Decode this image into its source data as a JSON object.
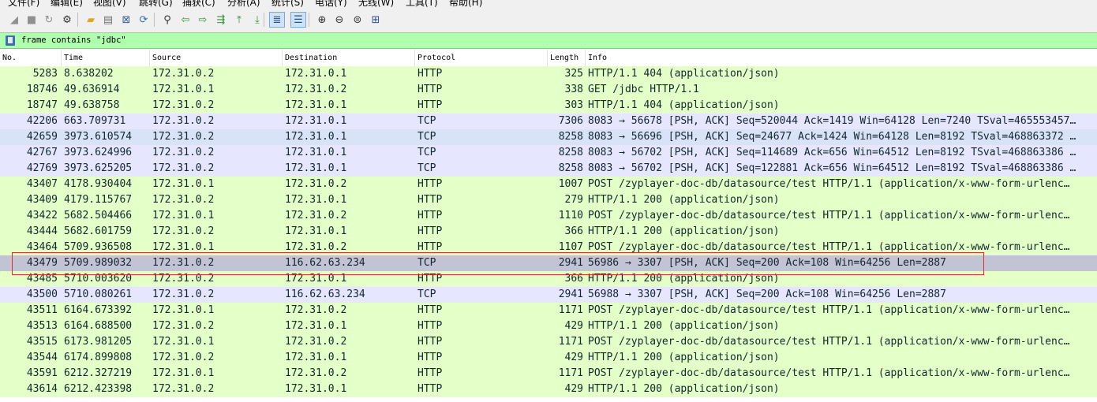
{
  "menu": [
    "文件(F)",
    "编辑(E)",
    "视图(V)",
    "跳转(G)",
    "捕获(C)",
    "分析(A)",
    "统计(S)",
    "电话(Y)",
    "无线(W)",
    "工具(T)",
    "帮助(H)"
  ],
  "toolbar": {
    "icons": [
      {
        "name": "start-capture-icon",
        "glyph": "◢",
        "color": "#909090"
      },
      {
        "name": "stop-capture-icon",
        "glyph": "■",
        "color": "#909090"
      },
      {
        "name": "restart-capture-icon",
        "glyph": "↻",
        "color": "#909090"
      },
      {
        "name": "capture-options-icon",
        "glyph": "⚙",
        "color": "#333333"
      },
      {
        "name": "open-file-icon",
        "glyph": "▰",
        "color": "#e0a526"
      },
      {
        "name": "save-file-icon",
        "glyph": "▤",
        "color": "#707070"
      },
      {
        "name": "close-file-icon",
        "glyph": "⊠",
        "color": "#3a5f9a"
      },
      {
        "name": "reload-file-icon",
        "glyph": "⟳",
        "color": "#2f6fb4"
      },
      {
        "name": "find-packet-icon",
        "glyph": "⚲",
        "color": "#303030"
      },
      {
        "name": "go-back-icon",
        "glyph": "⇦",
        "color": "#3e8f3e"
      },
      {
        "name": "go-forward-icon",
        "glyph": "⇨",
        "color": "#3e8f3e"
      },
      {
        "name": "go-to-packet-icon",
        "glyph": "⇶",
        "color": "#3e8f3e"
      },
      {
        "name": "go-first-packet-icon",
        "glyph": "⤒",
        "color": "#3e8f3e"
      },
      {
        "name": "go-last-packet-icon",
        "glyph": "⤓",
        "color": "#3e8f3e"
      },
      {
        "name": "auto-scroll-icon",
        "glyph": "≣",
        "color": "#2b4f8a"
      },
      {
        "name": "colorize-icon",
        "glyph": "☰",
        "color": "#2b4f8a"
      },
      {
        "name": "zoom-in-icon",
        "glyph": "⊕",
        "color": "#303030"
      },
      {
        "name": "zoom-out-icon",
        "glyph": "⊖",
        "color": "#303030"
      },
      {
        "name": "normal-size-icon",
        "glyph": "⊜",
        "color": "#303030"
      },
      {
        "name": "resize-columns-icon",
        "glyph": "⊞",
        "color": "#2b4f8a"
      }
    ]
  },
  "filter": {
    "text": "frame contains \"jdbc\"",
    "bg_color": "#afffaf"
  },
  "columns": {
    "no": "No.",
    "time": "Time",
    "source": "Source",
    "destination": "Destination",
    "protocol": "Protocol",
    "length": "Length",
    "info": "Info"
  },
  "packets": [
    {
      "no": "5283",
      "time": "8.638202",
      "src": "172.31.0.2",
      "dst": "172.31.0.1",
      "proto": "HTTP",
      "len": "325",
      "info": "HTTP/1.1 404   (application/json)",
      "color": "http"
    },
    {
      "no": "18746",
      "time": "49.636914",
      "src": "172.31.0.1",
      "dst": "172.31.0.2",
      "proto": "HTTP",
      "len": "338",
      "info": "GET /jdbc HTTP/1.1",
      "color": "http"
    },
    {
      "no": "18747",
      "time": "49.638758",
      "src": "172.31.0.2",
      "dst": "172.31.0.1",
      "proto": "HTTP",
      "len": "303",
      "info": "HTTP/1.1 404   (application/json)",
      "color": "http"
    },
    {
      "no": "42206",
      "time": "663.709731",
      "src": "172.31.0.2",
      "dst": "172.31.0.1",
      "proto": "TCP",
      "len": "7306",
      "info": "8083 → 56678 [PSH, ACK] Seq=520044 Ack=1419 Win=64128 Len=7240 TSval=465553457…",
      "color": "tcp"
    },
    {
      "no": "42659",
      "time": "3973.610574",
      "src": "172.31.0.2",
      "dst": "172.31.0.1",
      "proto": "TCP",
      "len": "8258",
      "info": "8083 → 56696 [PSH, ACK] Seq=24677 Ack=1424 Win=64128 Len=8192 TSval=468863372 …",
      "color": "tcp-alt"
    },
    {
      "no": "42767",
      "time": "3973.624996",
      "src": "172.31.0.2",
      "dst": "172.31.0.1",
      "proto": "TCP",
      "len": "8258",
      "info": "8083 → 56702 [PSH, ACK] Seq=114689 Ack=656 Win=64512 Len=8192 TSval=468863386 …",
      "color": "tcp"
    },
    {
      "no": "42769",
      "time": "3973.625205",
      "src": "172.31.0.2",
      "dst": "172.31.0.1",
      "proto": "TCP",
      "len": "8258",
      "info": "8083 → 56702 [PSH, ACK] Seq=122881 Ack=656 Win=64512 Len=8192 TSval=468863386 …",
      "color": "tcp"
    },
    {
      "no": "43407",
      "time": "4178.930404",
      "src": "172.31.0.1",
      "dst": "172.31.0.2",
      "proto": "HTTP",
      "len": "1007",
      "info": "POST /zyplayer-doc-db/datasource/test HTTP/1.1  (application/x-www-form-urlenc…",
      "color": "http"
    },
    {
      "no": "43409",
      "time": "4179.115767",
      "src": "172.31.0.2",
      "dst": "172.31.0.1",
      "proto": "HTTP",
      "len": "279",
      "info": "HTTP/1.1 200   (application/json)",
      "color": "http"
    },
    {
      "no": "43422",
      "time": "5682.504466",
      "src": "172.31.0.1",
      "dst": "172.31.0.2",
      "proto": "HTTP",
      "len": "1110",
      "info": "POST /zyplayer-doc-db/datasource/test HTTP/1.1  (application/x-www-form-urlenc…",
      "color": "http"
    },
    {
      "no": "43444",
      "time": "5682.601759",
      "src": "172.31.0.2",
      "dst": "172.31.0.1",
      "proto": "HTTP",
      "len": "366",
      "info": "HTTP/1.1 200   (application/json)",
      "color": "http"
    },
    {
      "no": "43464",
      "time": "5709.936508",
      "src": "172.31.0.1",
      "dst": "172.31.0.2",
      "proto": "HTTP",
      "len": "1107",
      "info": "POST /zyplayer-doc-db/datasource/test HTTP/1.1  (application/x-www-form-urlenc…",
      "color": "http"
    },
    {
      "no": "43479",
      "time": "5709.989032",
      "src": "172.31.0.2",
      "dst": "116.62.63.234",
      "proto": "TCP",
      "len": "2941",
      "info": "56986 → 3307 [PSH, ACK] Seq=200 Ack=108 Win=64256 Len=2887",
      "color": "selected"
    },
    {
      "no": "43485",
      "time": "5710.003620",
      "src": "172.31.0.2",
      "dst": "172.31.0.1",
      "proto": "HTTP",
      "len": "366",
      "info": "HTTP/1.1 200   (application/json)",
      "color": "http"
    },
    {
      "no": "43500",
      "time": "5710.080261",
      "src": "172.31.0.2",
      "dst": "116.62.63.234",
      "proto": "TCP",
      "len": "2941",
      "info": "56988 → 3307 [PSH, ACK] Seq=200 Ack=108 Win=64256 Len=2887",
      "color": "tcp"
    },
    {
      "no": "43511",
      "time": "6164.673392",
      "src": "172.31.0.1",
      "dst": "172.31.0.2",
      "proto": "HTTP",
      "len": "1171",
      "info": "POST /zyplayer-doc-db/datasource/test HTTP/1.1  (application/x-www-form-urlenc…",
      "color": "http"
    },
    {
      "no": "43513",
      "time": "6164.688500",
      "src": "172.31.0.2",
      "dst": "172.31.0.1",
      "proto": "HTTP",
      "len": "429",
      "info": "HTTP/1.1 200   (application/json)",
      "color": "http"
    },
    {
      "no": "43515",
      "time": "6173.981205",
      "src": "172.31.0.1",
      "dst": "172.31.0.2",
      "proto": "HTTP",
      "len": "1171",
      "info": "POST /zyplayer-doc-db/datasource/test HTTP/1.1  (application/x-www-form-urlenc…",
      "color": "http"
    },
    {
      "no": "43544",
      "time": "6174.899808",
      "src": "172.31.0.2",
      "dst": "172.31.0.1",
      "proto": "HTTP",
      "len": "429",
      "info": "HTTP/1.1 200   (application/json)",
      "color": "http"
    },
    {
      "no": "43591",
      "time": "6212.327219",
      "src": "172.31.0.1",
      "dst": "172.31.0.2",
      "proto": "HTTP",
      "len": "1171",
      "info": "POST /zyplayer-doc-db/datasource/test HTTP/1.1  (application/x-www-form-urlenc…",
      "color": "http"
    },
    {
      "no": "43614",
      "time": "6212.423398",
      "src": "172.31.0.2",
      "dst": "172.31.0.1",
      "proto": "HTTP",
      "len": "429",
      "info": "HTTP/1.1 200   (application/json)",
      "color": "http"
    }
  ],
  "colors": {
    "http_row": "#e4ffc7",
    "tcp_row": "#e7e6ff",
    "selected_row": "#c3c3d6",
    "highlight_border": "#d9302c"
  }
}
